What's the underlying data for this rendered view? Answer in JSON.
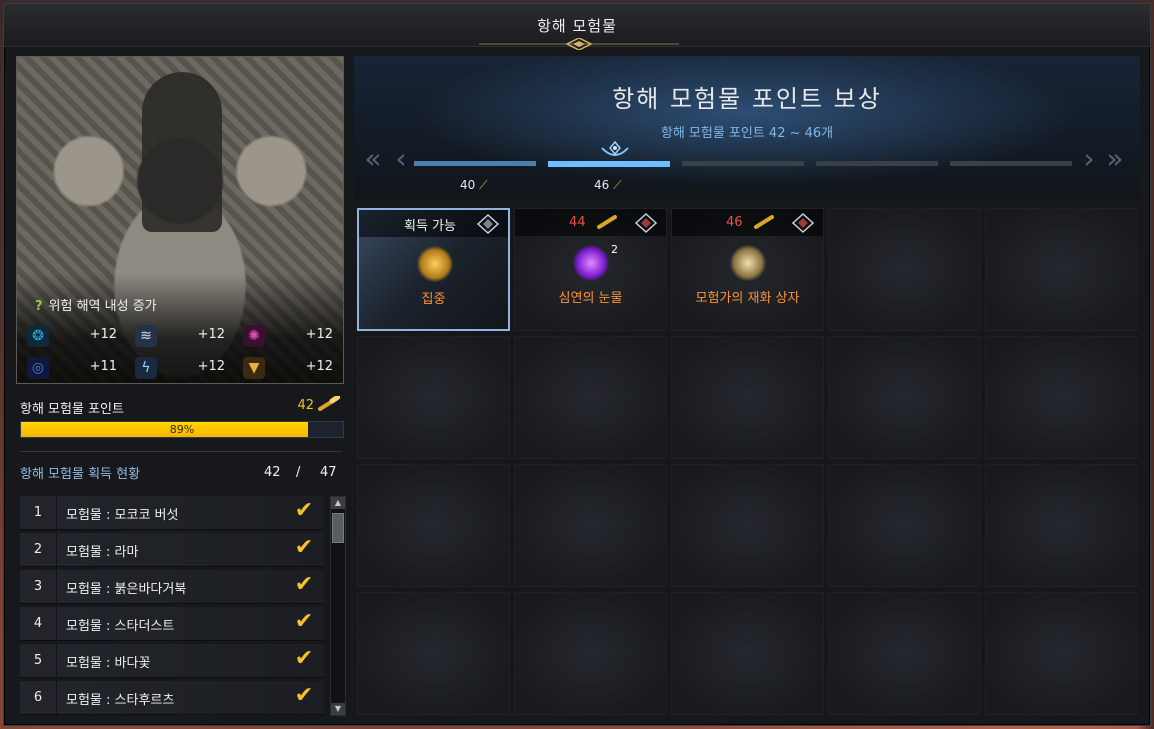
{
  "window": {
    "title": "항해 모험물"
  },
  "left_panel": {
    "resistance_title": "위험 해역 내성 증가",
    "resistances": [
      {
        "icon": "wave-swirl-icon",
        "value": "+12",
        "color": "#2fa8d8"
      },
      {
        "icon": "storm-icon",
        "value": "+12",
        "color": "#9fb6d0"
      },
      {
        "icon": "dragon-icon",
        "value": "+12",
        "color": "#d04aa8"
      },
      {
        "icon": "whirlpool-icon",
        "value": "+11",
        "color": "#3a5fd0"
      },
      {
        "icon": "lightning-icon",
        "value": "+12",
        "color": "#7ab4e8"
      },
      {
        "icon": "tornado-icon",
        "value": "+12",
        "color": "#d8a030"
      }
    ],
    "points_label": "항해 모험물 포인트",
    "points_value": "42",
    "progress_percent": 89,
    "progress_text": "89%",
    "status_label": "항해 모험물 획득 현황",
    "status_current": "42",
    "status_sep": "/",
    "status_total": "47",
    "items": [
      {
        "num": "1",
        "name": "모험물 : 모코코 버섯",
        "done": true
      },
      {
        "num": "2",
        "name": "모험물 : 라마",
        "done": true
      },
      {
        "num": "3",
        "name": "모험물 : 붉은바다거북",
        "done": true
      },
      {
        "num": "4",
        "name": "모험물 : 스타더스트",
        "done": true
      },
      {
        "num": "5",
        "name": "모험물 : 바다꽃",
        "done": true
      },
      {
        "num": "6",
        "name": "모험물 : 스타후르츠",
        "done": true
      }
    ],
    "colors": {
      "accent_gold": "#f2c227",
      "progress_fill": "#ffd600",
      "status_blue": "#93bde0"
    }
  },
  "reward_panel": {
    "title": "항해 모험물 포인트 보상",
    "subtitle": "항해 모험물 포인트 42 ~ 46개",
    "tiers": [
      {
        "label": "40",
        "state": "done"
      },
      {
        "label": "46",
        "state": "active"
      },
      {
        "label": "",
        "state": "locked"
      },
      {
        "label": "",
        "state": "locked"
      },
      {
        "label": "",
        "state": "locked"
      }
    ],
    "rewards": [
      {
        "status": "획득 가능",
        "point": "",
        "item_icon": "medal-coin-icon",
        "qty": "",
        "name": "집중",
        "active": true
      },
      {
        "status": "",
        "point": "44",
        "item_icon": "purple-gem-icon",
        "qty": "2",
        "name": "심연의 눈물",
        "active": false
      },
      {
        "status": "",
        "point": "46",
        "item_icon": "treasure-chest-icon",
        "qty": "",
        "name": "모험가의 재화 상자",
        "active": false
      }
    ],
    "empty_cells": 17,
    "colors": {
      "point_red": "#e5514a",
      "reward_orange": "#ff9236",
      "tier_active": "#6cc0ff"
    }
  }
}
